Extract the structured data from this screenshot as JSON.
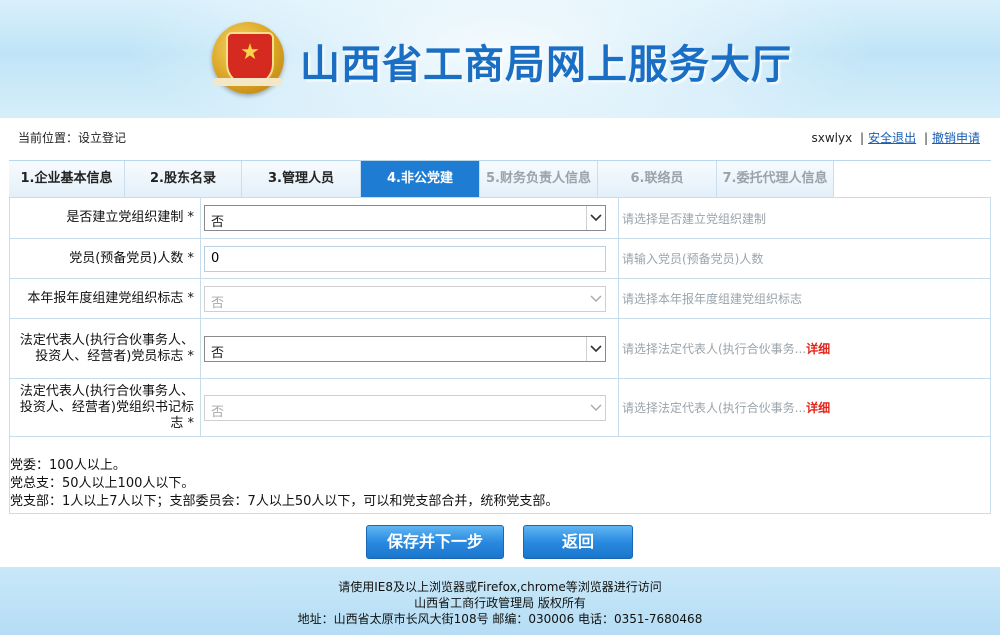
{
  "header": {
    "site_title": "山西省工商局网上服务大厅"
  },
  "locbar": {
    "location": "当前位置：设立登记",
    "username": "sxwlyx",
    "sep": "|",
    "logout": "安全退出",
    "cancel_application": "撤销申请"
  },
  "tabs": [
    {
      "label": "1.企业基本信息",
      "state": "normal"
    },
    {
      "label": "2.股东名录",
      "state": "normal"
    },
    {
      "label": "3.管理人员",
      "state": "normal"
    },
    {
      "label": "4.非公党建",
      "state": "active"
    },
    {
      "label": "5.财务负责人信息",
      "state": "disabled"
    },
    {
      "label": "6.联络员",
      "state": "disabled"
    },
    {
      "label": "7.委托代理人信息",
      "state": "disabled"
    }
  ],
  "form": {
    "rows": [
      {
        "label": "是否建立党组织建制 *",
        "value": "否",
        "hint": "请选择是否建立党组织建制",
        "more": ""
      },
      {
        "label": "党员(预备党员)人数 *",
        "value": "0",
        "hint": "请输入党员(预备党员)人数",
        "more": ""
      },
      {
        "label": "本年报年度组建党组织标志 *",
        "value": "否",
        "hint": "请选择本年报年度组建党组织标志",
        "more": ""
      },
      {
        "label": "法定代表人(执行合伙事务人、投资人、经营者)党员标志 *",
        "value": "否",
        "hint": "请选择法定代表人(执行合伙事务...",
        "more": "详细"
      },
      {
        "label": "法定代表人(执行合伙事务人、投资人、经营者)党组织书记标志 *",
        "value": "否",
        "hint": "请选择法定代表人(执行合伙事务...",
        "more": "详细"
      }
    ],
    "notes": [
      "党委：100人以上。",
      "党总支：50人以上100人以下。",
      "党支部：1人以上7人以下；支部委员会：7人以上50人以下，可以和党支部合并，统称党支部。"
    ]
  },
  "buttons": {
    "save_next": "保存并下一步",
    "back": "返回"
  },
  "footer": {
    "line1": "请使用IE8及以上浏览器或Firefox,chrome等浏览器进行访问",
    "line2": "山西省工商行政管理局 版权所有",
    "line3": "地址：山西省太原市长风大街108号 邮编：030006 电话：0351-7680468"
  },
  "colors": {
    "accent": "#1e7cd2",
    "title": "#1a6fc4",
    "link": "#1a5fb4",
    "more": "#e0261c"
  }
}
